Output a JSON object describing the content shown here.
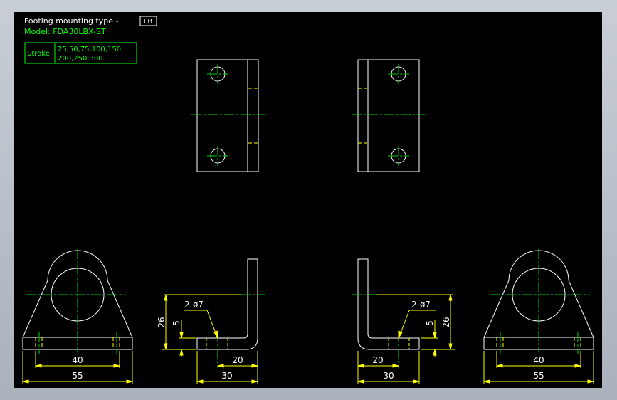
{
  "title": {
    "prefix": "Footing mounting type -",
    "code": "LB",
    "model": "Model: FDA30LBX-ST"
  },
  "stroke_table": {
    "label": "Stroke",
    "values_line1": "25,50,75,100,150,",
    "values_line2": "200,250,300"
  },
  "dimensions": {
    "width_40": "40",
    "width_55": "55",
    "height_26": "26",
    "thickness_5": "5",
    "hole_note": "2-ø7",
    "base_20": "20",
    "base_30": "30"
  },
  "colors": {
    "background": "#000000",
    "outline": "#ffffff",
    "centerline": "#00d000",
    "dimension": "#ffff00",
    "model_text": "#00ff00"
  }
}
